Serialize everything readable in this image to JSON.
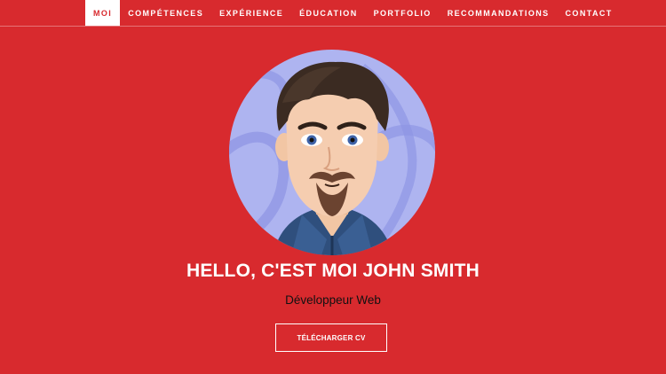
{
  "nav": {
    "items": [
      {
        "label": "MOI",
        "active": true
      },
      {
        "label": "COMPÉTENCES",
        "active": false
      },
      {
        "label": "EXPÉRIENCE",
        "active": false
      },
      {
        "label": "ÉDUCATION",
        "active": false
      },
      {
        "label": "PORTFOLIO",
        "active": false
      },
      {
        "label": "RECOMMANDATIONS",
        "active": false
      },
      {
        "label": "CONTACT",
        "active": false
      }
    ]
  },
  "hero": {
    "avatar_icon": "cartoon-avatar-illustration",
    "title": "HELLO, C'EST MOI JOHN SMITH",
    "subtitle": "Développeur Web",
    "cv_button_label": "TÉLÉCHARGER CV"
  },
  "colors": {
    "background": "#d82a2e",
    "text": "#ffffff",
    "subtitle": "#111111",
    "avatar_background": "#aeb4f0"
  }
}
